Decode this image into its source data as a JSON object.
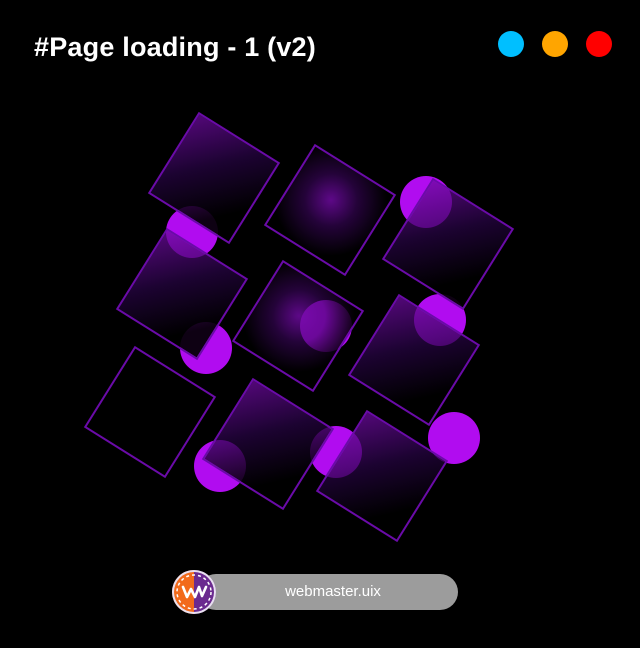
{
  "header": {
    "title": "#Page loading - 1 (v2)"
  },
  "window_controls": {
    "colors": [
      "#00bfff",
      "#ffa500",
      "#ff0000"
    ]
  },
  "colors": {
    "accent": "#b10cf0",
    "tile_border": "#6a0ba8",
    "background": "#000000"
  },
  "badge": {
    "label": "webmaster.uix",
    "logo_icon": "wm-logo-icon"
  }
}
